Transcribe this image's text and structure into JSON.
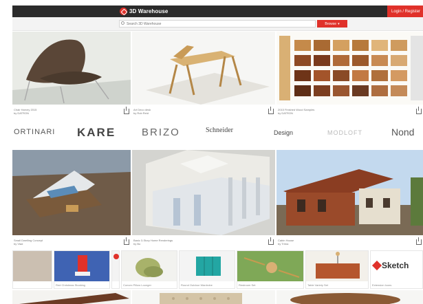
{
  "header": {
    "logo_text": "3D Warehouse",
    "signin_label": "Login / Register"
  },
  "search": {
    "placeholder": "Search 3D Warehouse",
    "browse_label": "Browse"
  },
  "row1": [
    {
      "title": "Chair Harvey 2015",
      "author": "by DATRON"
    },
    {
      "title": "Art Deco desk",
      "author": "by Rob Reid"
    },
    {
      "title": "2015 Finished Wood Samples",
      "author": "by DATRON"
    }
  ],
  "brands": [
    "ORTINARI",
    "KARE",
    "BRIZO",
    "Schneider",
    "Design",
    "MODLOFT",
    "Nond"
  ],
  "row2": [
    {
      "title": "Small Dwelling Concept",
      "author": "by Vlad"
    },
    {
      "title": "Basic 3-Story Home Renderings",
      "author": "by Bo"
    },
    {
      "title": "Cabin House",
      "author": "by Trima"
    }
  ],
  "materials": [
    {
      "label": ""
    },
    {
      "label": "Red Christmas Stocking"
    },
    {
      "label": ""
    },
    {
      "label": "Convex Pillow Lounger"
    },
    {
      "label": "Round Outdoor Wardrobe"
    },
    {
      "label": "Restroom Set"
    },
    {
      "label": "Table Variety Set"
    },
    {
      "label": "Extension Icons",
      "brand": "Sketch"
    }
  ],
  "colors": {
    "accent": "#e0312a",
    "topbar": "#2b2b2b"
  }
}
